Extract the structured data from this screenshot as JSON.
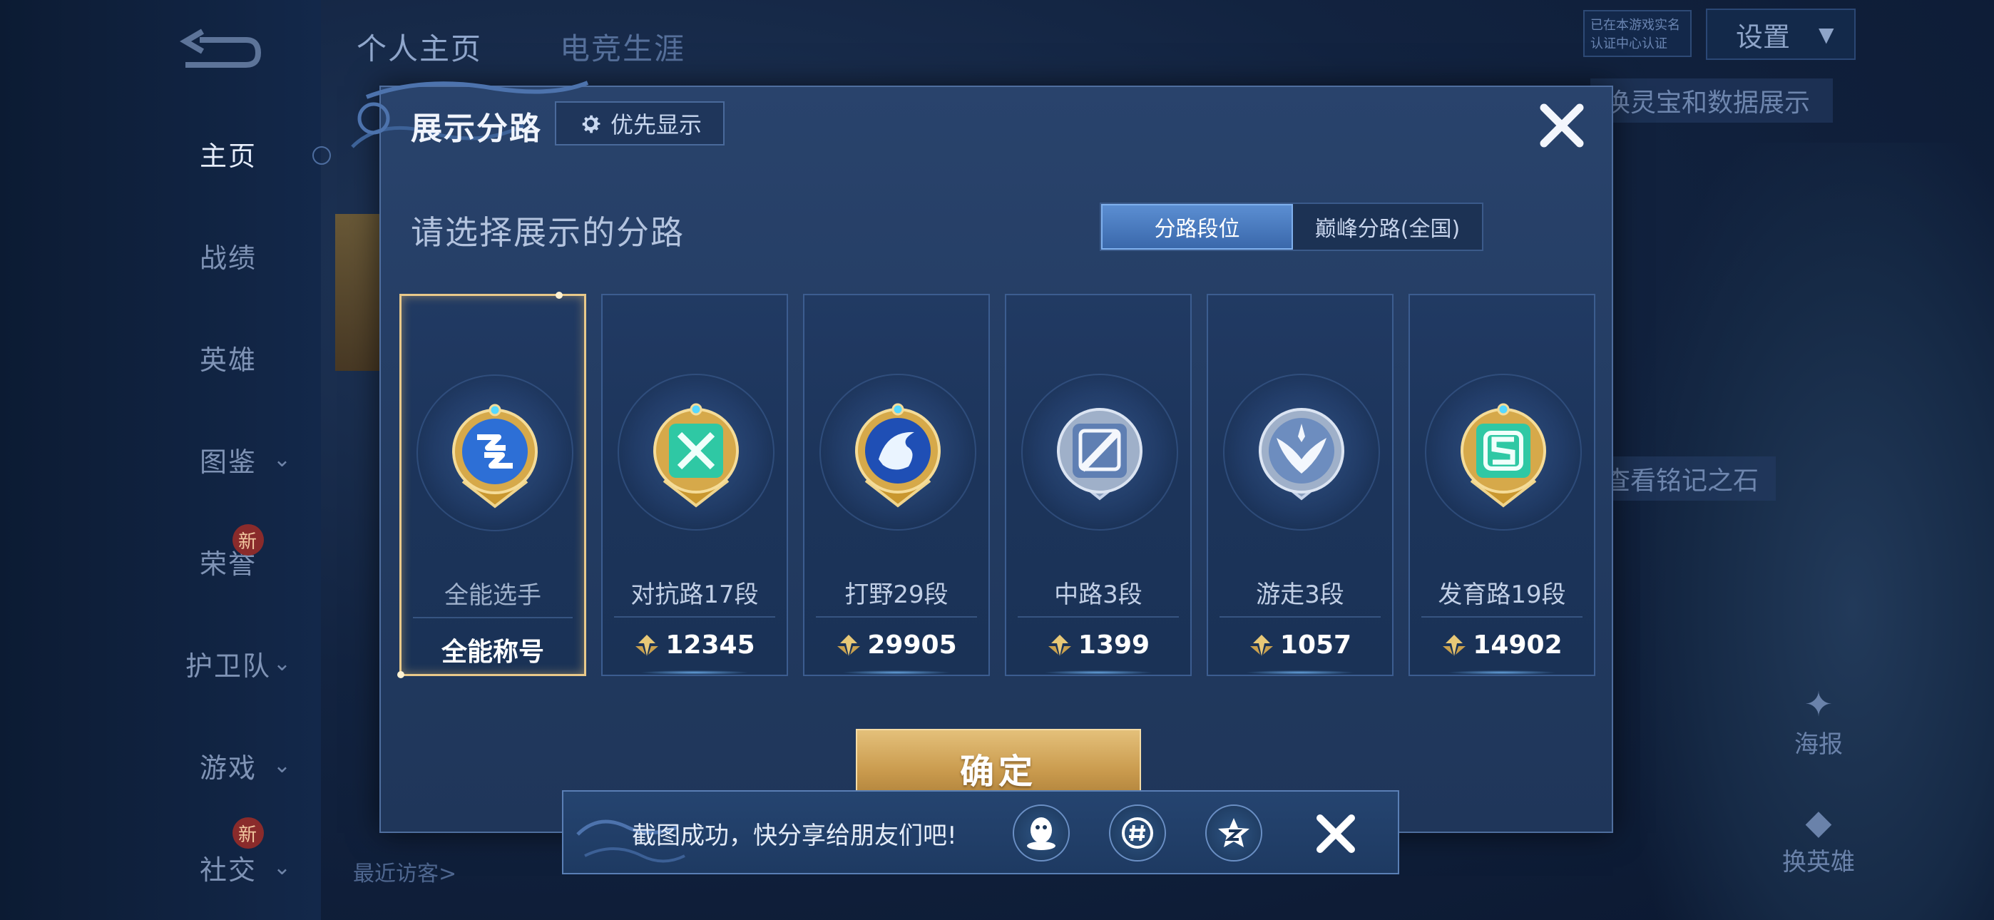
{
  "background": {
    "nav": [
      {
        "label": "主页",
        "active": true
      },
      {
        "label": "战绩"
      },
      {
        "label": "英雄"
      },
      {
        "label": "图鉴",
        "chevron": "⌄"
      },
      {
        "label": "荣誉",
        "badge": "新"
      },
      {
        "label": "护卫队",
        "chevron": "⌄"
      },
      {
        "label": "游戏",
        "chevron": "⌄"
      },
      {
        "label": "社交",
        "chevron": "⌄",
        "badge": "新"
      }
    ],
    "top_tabs": [
      "个人主页",
      "电竞生涯"
    ],
    "verify": [
      "已在本游戏实名",
      "认证中心认证"
    ],
    "settings_label": "设置",
    "strip_top": "换灵宝和数据展示",
    "strip_mid": "查看铭记之石",
    "poster_label": "海报",
    "swap_hero_label": "换英雄",
    "visitor_label": "最近访客>"
  },
  "modal": {
    "title": "展示分路",
    "priority_label": "优先显示",
    "subtitle": "请选择展示的分路",
    "seg_tabs": [
      {
        "label": "分路段位",
        "active": true
      },
      {
        "label": "巅峰分路(全国)",
        "active": false
      }
    ],
    "cards": [
      {
        "name": "全能选手",
        "score": "全能称号",
        "icon": "all-round-badge-icon",
        "selected": true,
        "color": "#2d6fd6"
      },
      {
        "name": "对抗路17段",
        "score": "12345",
        "icon": "clash-lane-badge-icon",
        "color": "#2fc8a4"
      },
      {
        "name": "打野29段",
        "score": "29905",
        "icon": "jungle-badge-icon",
        "color": "#2b5fcf"
      },
      {
        "name": "中路3段",
        "score": "1399",
        "icon": "mid-lane-badge-icon",
        "color": "#6f8fbf"
      },
      {
        "name": "游走3段",
        "score": "1057",
        "icon": "roam-badge-icon",
        "color": "#7d9bc8"
      },
      {
        "name": "发育路19段",
        "score": "14902",
        "icon": "farm-lane-badge-icon",
        "color": "#2fc8a4"
      }
    ],
    "confirm_label": "确定"
  },
  "share": {
    "text": "截图成功，快分享给朋友们吧!",
    "icons": [
      "qq-icon",
      "wechat-moments-icon",
      "qzone-icon"
    ]
  },
  "colors": {
    "gold": "#e9c98a",
    "confirm": "#c99a4d",
    "modal_bg": "#223a60"
  }
}
